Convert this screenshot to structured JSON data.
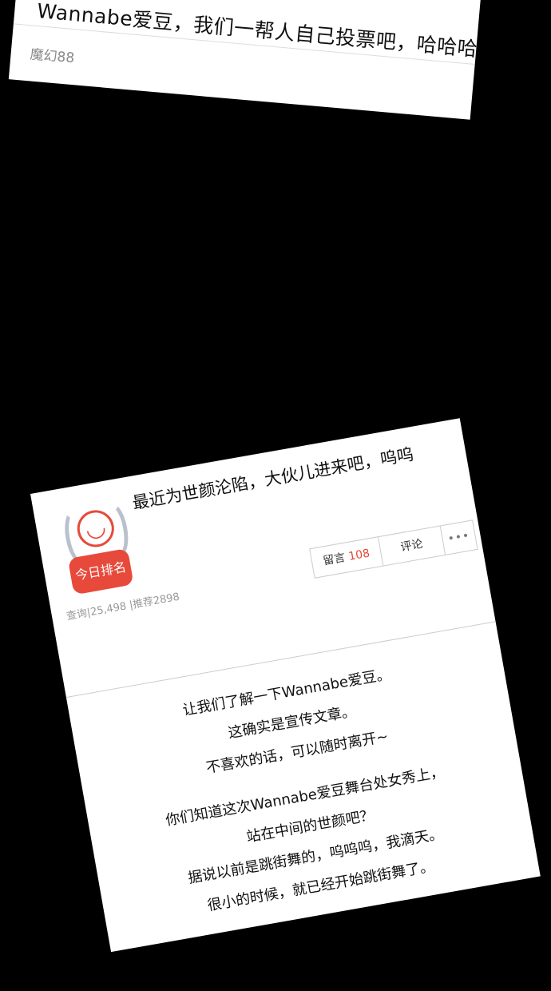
{
  "top_card": {
    "line": "Wannabe爱豆，我们一帮人自己投票吧，哈哈哈",
    "author": "魔幻88"
  },
  "post": {
    "title": "最近为世颜沦陷，大伙儿进来吧，呜呜",
    "badge_label": "今日排名",
    "stats": "查询|25,498 |推荐2898",
    "actions": {
      "message_label": "留言",
      "message_count": "108",
      "comment_label": "评论",
      "more_label": "•••"
    },
    "paragraph1": [
      "让我们了解一下Wannabe爱豆。",
      "这确实是宣传文章。",
      "不喜欢的话，可以随时离开~"
    ],
    "paragraph2": [
      "你们知道这次Wannabe爱豆舞台处女秀上，",
      "站在中间的世颜吧？",
      "据说以前是跳街舞的，呜呜呜，我滴天。",
      "很小的时候，就已经开始跳街舞了。"
    ]
  },
  "colors": {
    "accent": "#e7493a",
    "background": "#000000"
  }
}
